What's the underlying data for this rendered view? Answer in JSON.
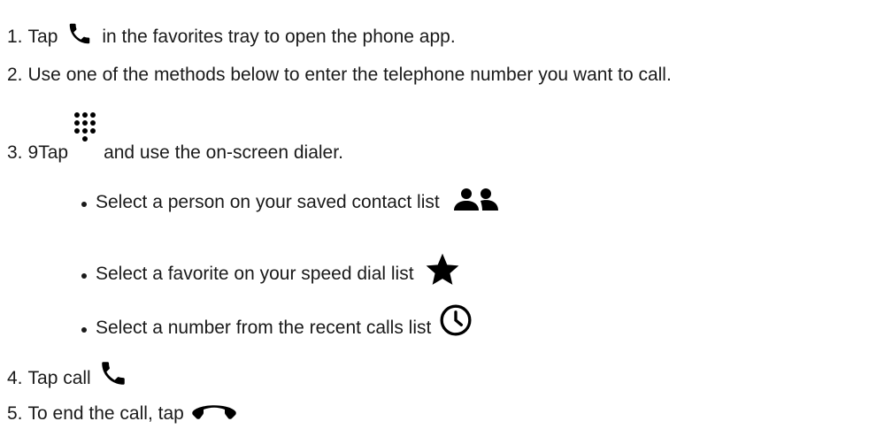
{
  "steps": [
    {
      "number": "1.",
      "before": "Tap",
      "icon": "phone-icon",
      "after": "in the favorites tray to open the phone app."
    },
    {
      "number": "2.",
      "text": "Use one of the methods below to enter the telephone number you want to call."
    },
    {
      "number": "3.",
      "before": "9Tap",
      "icon": "dialpad-icon",
      "after": "and use the on-screen dialer."
    },
    {
      "number": "4.",
      "before": "Tap call",
      "icon": "phone-icon"
    },
    {
      "number": "5.",
      "before": "To end the call, tap",
      "icon": "end-call-icon"
    }
  ],
  "methods": [
    {
      "text": "Select a person on your saved contact list",
      "icon": "contacts-icon"
    },
    {
      "text": "Select a favorite on your speed dial list",
      "icon": "star-icon"
    },
    {
      "text": "Select a number from the recent calls list",
      "icon": "clock-icon"
    }
  ]
}
